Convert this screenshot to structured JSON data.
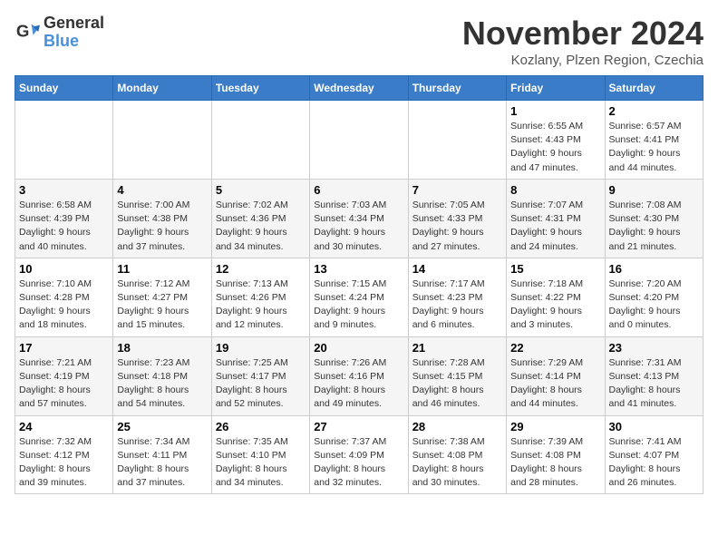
{
  "header": {
    "logo_line1": "General",
    "logo_line2": "Blue",
    "month": "November 2024",
    "location": "Kozlany, Plzen Region, Czechia"
  },
  "weekdays": [
    "Sunday",
    "Monday",
    "Tuesday",
    "Wednesday",
    "Thursday",
    "Friday",
    "Saturday"
  ],
  "weeks": [
    [
      {
        "day": "",
        "info": ""
      },
      {
        "day": "",
        "info": ""
      },
      {
        "day": "",
        "info": ""
      },
      {
        "day": "",
        "info": ""
      },
      {
        "day": "",
        "info": ""
      },
      {
        "day": "1",
        "info": "Sunrise: 6:55 AM\nSunset: 4:43 PM\nDaylight: 9 hours\nand 47 minutes."
      },
      {
        "day": "2",
        "info": "Sunrise: 6:57 AM\nSunset: 4:41 PM\nDaylight: 9 hours\nand 44 minutes."
      }
    ],
    [
      {
        "day": "3",
        "info": "Sunrise: 6:58 AM\nSunset: 4:39 PM\nDaylight: 9 hours\nand 40 minutes."
      },
      {
        "day": "4",
        "info": "Sunrise: 7:00 AM\nSunset: 4:38 PM\nDaylight: 9 hours\nand 37 minutes."
      },
      {
        "day": "5",
        "info": "Sunrise: 7:02 AM\nSunset: 4:36 PM\nDaylight: 9 hours\nand 34 minutes."
      },
      {
        "day": "6",
        "info": "Sunrise: 7:03 AM\nSunset: 4:34 PM\nDaylight: 9 hours\nand 30 minutes."
      },
      {
        "day": "7",
        "info": "Sunrise: 7:05 AM\nSunset: 4:33 PM\nDaylight: 9 hours\nand 27 minutes."
      },
      {
        "day": "8",
        "info": "Sunrise: 7:07 AM\nSunset: 4:31 PM\nDaylight: 9 hours\nand 24 minutes."
      },
      {
        "day": "9",
        "info": "Sunrise: 7:08 AM\nSunset: 4:30 PM\nDaylight: 9 hours\nand 21 minutes."
      }
    ],
    [
      {
        "day": "10",
        "info": "Sunrise: 7:10 AM\nSunset: 4:28 PM\nDaylight: 9 hours\nand 18 minutes."
      },
      {
        "day": "11",
        "info": "Sunrise: 7:12 AM\nSunset: 4:27 PM\nDaylight: 9 hours\nand 15 minutes."
      },
      {
        "day": "12",
        "info": "Sunrise: 7:13 AM\nSunset: 4:26 PM\nDaylight: 9 hours\nand 12 minutes."
      },
      {
        "day": "13",
        "info": "Sunrise: 7:15 AM\nSunset: 4:24 PM\nDaylight: 9 hours\nand 9 minutes."
      },
      {
        "day": "14",
        "info": "Sunrise: 7:17 AM\nSunset: 4:23 PM\nDaylight: 9 hours\nand 6 minutes."
      },
      {
        "day": "15",
        "info": "Sunrise: 7:18 AM\nSunset: 4:22 PM\nDaylight: 9 hours\nand 3 minutes."
      },
      {
        "day": "16",
        "info": "Sunrise: 7:20 AM\nSunset: 4:20 PM\nDaylight: 9 hours\nand 0 minutes."
      }
    ],
    [
      {
        "day": "17",
        "info": "Sunrise: 7:21 AM\nSunset: 4:19 PM\nDaylight: 8 hours\nand 57 minutes."
      },
      {
        "day": "18",
        "info": "Sunrise: 7:23 AM\nSunset: 4:18 PM\nDaylight: 8 hours\nand 54 minutes."
      },
      {
        "day": "19",
        "info": "Sunrise: 7:25 AM\nSunset: 4:17 PM\nDaylight: 8 hours\nand 52 minutes."
      },
      {
        "day": "20",
        "info": "Sunrise: 7:26 AM\nSunset: 4:16 PM\nDaylight: 8 hours\nand 49 minutes."
      },
      {
        "day": "21",
        "info": "Sunrise: 7:28 AM\nSunset: 4:15 PM\nDaylight: 8 hours\nand 46 minutes."
      },
      {
        "day": "22",
        "info": "Sunrise: 7:29 AM\nSunset: 4:14 PM\nDaylight: 8 hours\nand 44 minutes."
      },
      {
        "day": "23",
        "info": "Sunrise: 7:31 AM\nSunset: 4:13 PM\nDaylight: 8 hours\nand 41 minutes."
      }
    ],
    [
      {
        "day": "24",
        "info": "Sunrise: 7:32 AM\nSunset: 4:12 PM\nDaylight: 8 hours\nand 39 minutes."
      },
      {
        "day": "25",
        "info": "Sunrise: 7:34 AM\nSunset: 4:11 PM\nDaylight: 8 hours\nand 37 minutes."
      },
      {
        "day": "26",
        "info": "Sunrise: 7:35 AM\nSunset: 4:10 PM\nDaylight: 8 hours\nand 34 minutes."
      },
      {
        "day": "27",
        "info": "Sunrise: 7:37 AM\nSunset: 4:09 PM\nDaylight: 8 hours\nand 32 minutes."
      },
      {
        "day": "28",
        "info": "Sunrise: 7:38 AM\nSunset: 4:08 PM\nDaylight: 8 hours\nand 30 minutes."
      },
      {
        "day": "29",
        "info": "Sunrise: 7:39 AM\nSunset: 4:08 PM\nDaylight: 8 hours\nand 28 minutes."
      },
      {
        "day": "30",
        "info": "Sunrise: 7:41 AM\nSunset: 4:07 PM\nDaylight: 8 hours\nand 26 minutes."
      }
    ]
  ]
}
